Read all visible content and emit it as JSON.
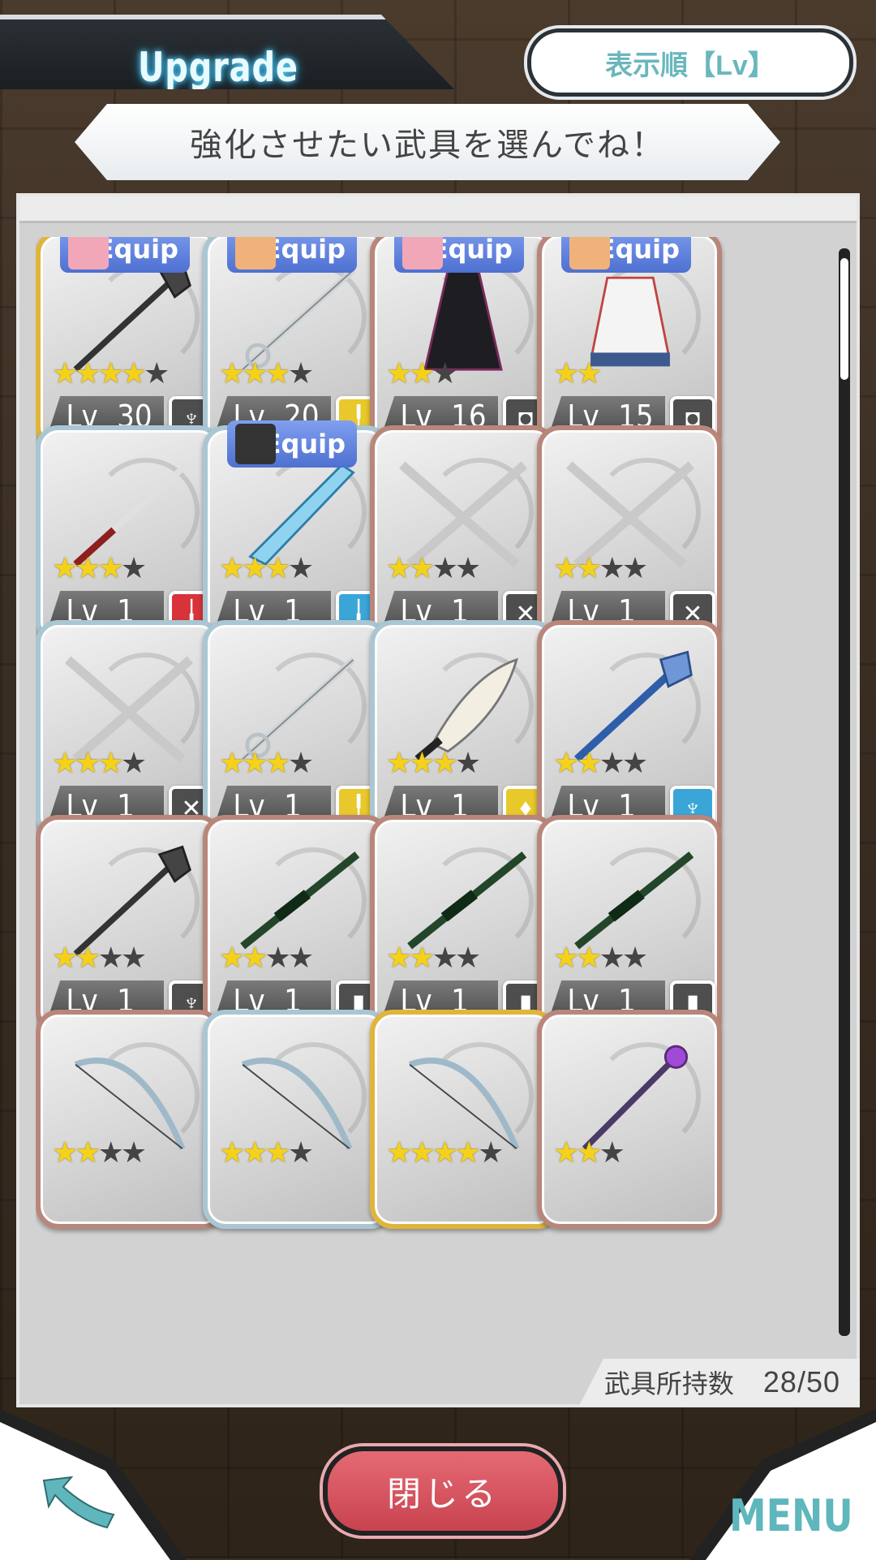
{
  "header": {
    "title": "Upgrade",
    "sort_label": "表示順【Lv】"
  },
  "banner": {
    "text": "強化させたい武具を選んでね！"
  },
  "grid": {
    "cards": [
      {
        "frame": "gold",
        "equip": "Equip",
        "equip_color": "#f2a7b8",
        "stars_on": 4,
        "stars_total": 5,
        "level": "Lv",
        "level_value": "30",
        "type_color": "gray",
        "type_icon": "spear-icon",
        "item_icon": "mace-icon"
      },
      {
        "frame": "silver",
        "equip": "Equip",
        "equip_color": "#f0b27a",
        "stars_on": 3,
        "stars_total": 4,
        "level": "Lv",
        "level_value": "20",
        "type_color": "yellow",
        "type_icon": "rapier-icon",
        "item_icon": "rapier-icon"
      },
      {
        "frame": "bronze",
        "equip": "Equip",
        "equip_color": "#f2a7b8",
        "stars_on": 2,
        "stars_total": 3,
        "level": "Lv",
        "level_value": "16",
        "type_color": "gray",
        "type_icon": "armor-icon",
        "item_icon": "cloak-icon"
      },
      {
        "frame": "bronze",
        "equip": "Equip",
        "equip_color": "#f0b27a",
        "stars_on": 2,
        "stars_total": 2,
        "level": "Lv",
        "level_value": "15",
        "type_color": "gray",
        "type_icon": "armor-icon",
        "item_icon": "apron-icon"
      },
      {
        "frame": "silver",
        "equip": "",
        "equip_color": "",
        "stars_on": 3,
        "stars_total": 4,
        "level": "Lv",
        "level_value": "1",
        "type_color": "red",
        "type_icon": "katana-icon",
        "item_icon": "katana-icon"
      },
      {
        "frame": "silver",
        "equip": "Equip",
        "equip_color": "#333333",
        "stars_on": 3,
        "stars_total": 4,
        "level": "Lv",
        "level_value": "1",
        "type_color": "blue",
        "type_icon": "sword-icon",
        "item_icon": "ice-sword-icon"
      },
      {
        "frame": "bronze",
        "equip": "",
        "equip_color": "",
        "stars_on": 2,
        "stars_total": 4,
        "level": "Lv",
        "level_value": "1",
        "type_color": "gray",
        "type_icon": "dual-swords-icon",
        "item_icon": "dual-swords-icon"
      },
      {
        "frame": "bronze",
        "equip": "",
        "equip_color": "",
        "stars_on": 2,
        "stars_total": 4,
        "level": "Lv",
        "level_value": "1",
        "type_color": "gray",
        "type_icon": "dual-swords-icon",
        "item_icon": "dual-swords-icon"
      },
      {
        "frame": "silver",
        "equip": "",
        "equip_color": "",
        "stars_on": 3,
        "stars_total": 4,
        "level": "Lv",
        "level_value": "1",
        "type_color": "gray",
        "type_icon": "dual-swords-icon",
        "item_icon": "dual-swords-icon"
      },
      {
        "frame": "silver",
        "equip": "",
        "equip_color": "",
        "stars_on": 3,
        "stars_total": 4,
        "level": "Lv",
        "level_value": "1",
        "type_color": "yellow",
        "type_icon": "rapier-icon",
        "item_icon": "rapier-icon"
      },
      {
        "frame": "silver",
        "equip": "",
        "equip_color": "",
        "stars_on": 3,
        "stars_total": 4,
        "level": "Lv",
        "level_value": "1",
        "type_color": "yellow",
        "type_icon": "dagger-icon",
        "item_icon": "dagger-icon"
      },
      {
        "frame": "bronze",
        "equip": "",
        "equip_color": "",
        "stars_on": 2,
        "stars_total": 4,
        "level": "Lv",
        "level_value": "1",
        "type_color": "blue",
        "type_icon": "hammer-icon",
        "item_icon": "hammer-icon"
      },
      {
        "frame": "bronze",
        "equip": "",
        "equip_color": "",
        "stars_on": 2,
        "stars_total": 4,
        "level": "Lv",
        "level_value": "1",
        "type_color": "gray",
        "type_icon": "spear-icon",
        "item_icon": "mace-icon"
      },
      {
        "frame": "bronze",
        "equip": "",
        "equip_color": "",
        "stars_on": 2,
        "stars_total": 4,
        "level": "Lv",
        "level_value": "1",
        "type_color": "gray",
        "type_icon": "bullet-icon",
        "item_icon": "rifle-icon"
      },
      {
        "frame": "bronze",
        "equip": "",
        "equip_color": "",
        "stars_on": 2,
        "stars_total": 4,
        "level": "Lv",
        "level_value": "1",
        "type_color": "gray",
        "type_icon": "bullet-icon",
        "item_icon": "rifle-icon"
      },
      {
        "frame": "bronze",
        "equip": "",
        "equip_color": "",
        "stars_on": 2,
        "stars_total": 4,
        "level": "Lv",
        "level_value": "1",
        "type_color": "gray",
        "type_icon": "bullet-icon",
        "item_icon": "rifle-icon"
      },
      {
        "frame": "bronze",
        "equip": "",
        "equip_color": "",
        "stars_on": 2,
        "stars_total": 4,
        "level": "",
        "level_value": "",
        "type_color": "",
        "type_icon": "",
        "item_icon": "bow-icon"
      },
      {
        "frame": "silver",
        "equip": "",
        "equip_color": "",
        "stars_on": 3,
        "stars_total": 4,
        "level": "",
        "level_value": "",
        "type_color": "",
        "type_icon": "",
        "item_icon": "bow-icon"
      },
      {
        "frame": "gold",
        "equip": "",
        "equip_color": "",
        "stars_on": 4,
        "stars_total": 5,
        "level": "",
        "level_value": "",
        "type_color": "",
        "type_icon": "",
        "item_icon": "bow-icon"
      },
      {
        "frame": "bronze",
        "equip": "",
        "equip_color": "",
        "stars_on": 2,
        "stars_total": 3,
        "level": "",
        "level_value": "",
        "type_color": "",
        "type_icon": "",
        "item_icon": "staff-icon"
      }
    ]
  },
  "footer": {
    "label": "武具所持数",
    "count": "28/50"
  },
  "bottom": {
    "close_label": "閉じる",
    "menu_label": "MENU",
    "back_icon": "back-arrow-icon"
  }
}
